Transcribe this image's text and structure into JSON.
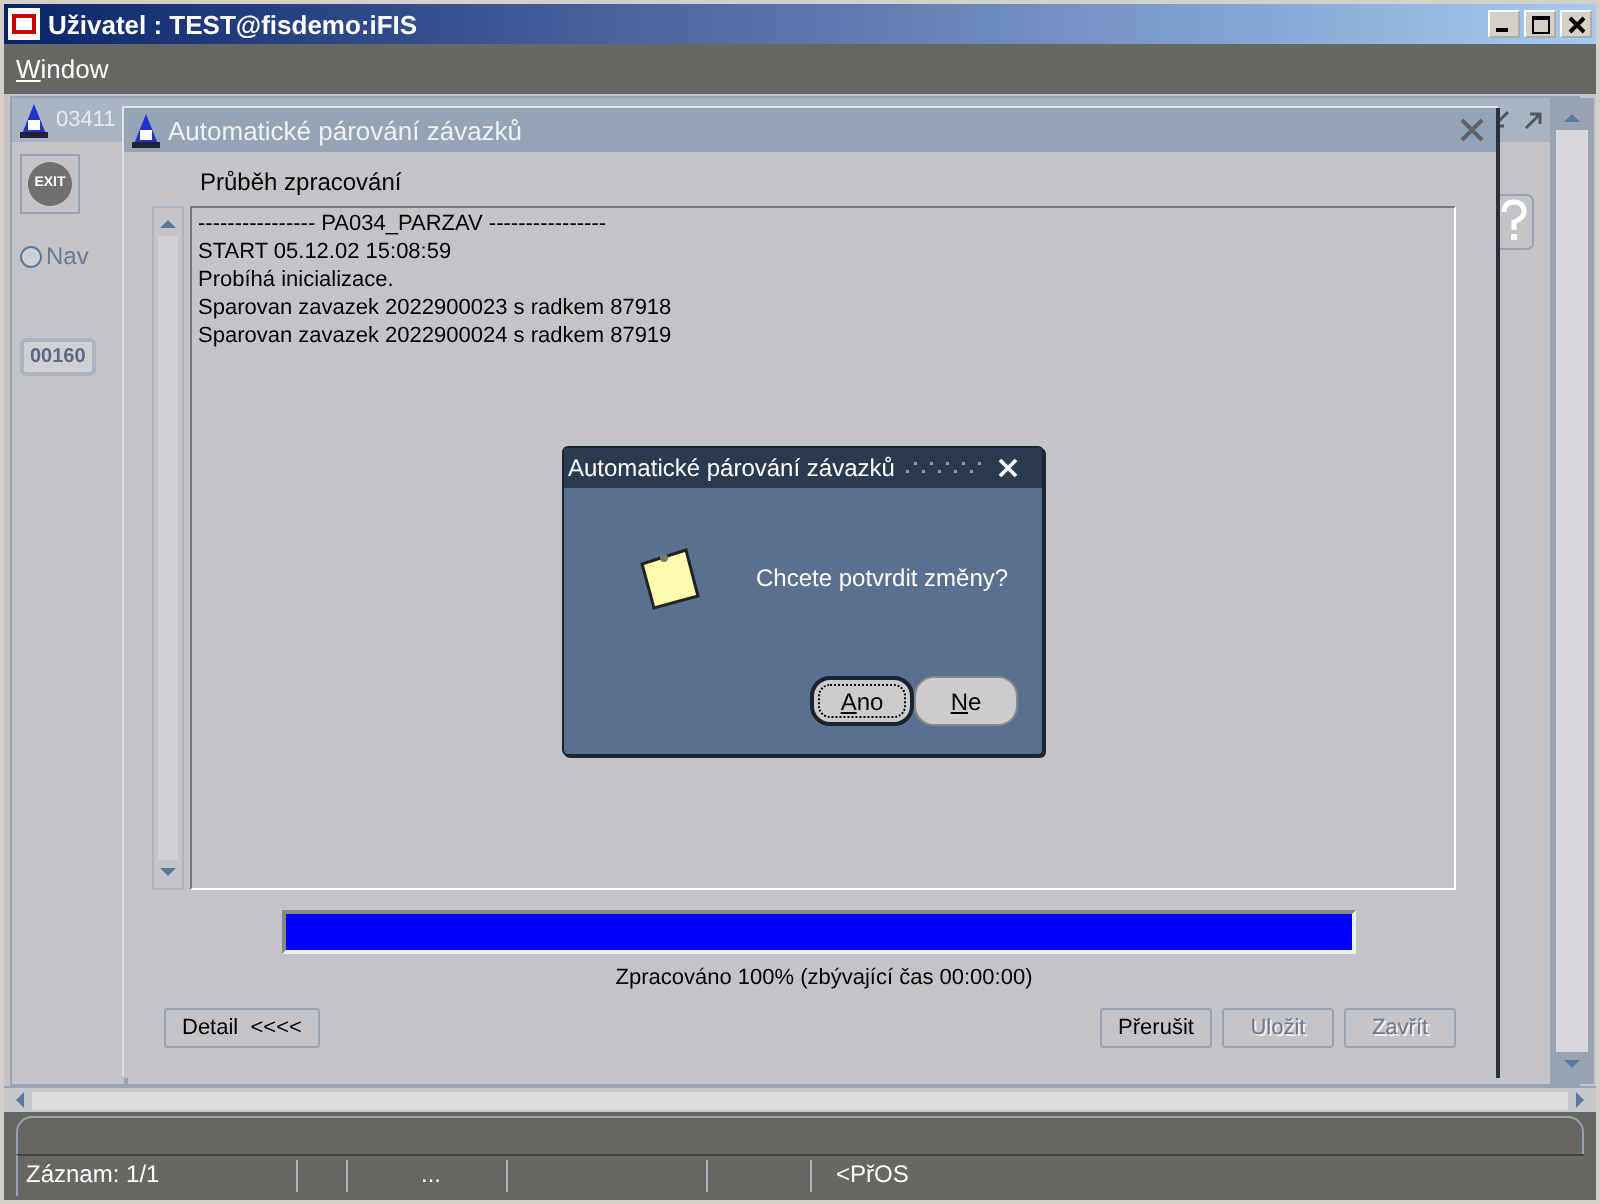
{
  "window": {
    "title": "Uživatel : TEST@fisdemo:iFIS"
  },
  "menu": [
    {
      "label": "Window"
    }
  ],
  "back_window": {
    "title": "03411",
    "toolbar_button": "EXIT",
    "nav_option": {
      "label": "Nav",
      "selected": false
    },
    "record_field": "00160"
  },
  "front_window": {
    "title": "Automatické párování závazků",
    "log_label": "Průběh zpracování",
    "log_lines": [
      "---------------- PA034_PARZAV ----------------",
      "START 05.12.02 15:08:59",
      "Probíhá inicializace.",
      "Sparovan zavazek 2022900023 s radkem 87918",
      "Sparovan zavazek 2022900024 s radkem 87919"
    ],
    "progress": {
      "level": 1,
      "caption": "Zpracováno 100% (zbývající čas 00:00:00)"
    },
    "buttons": [
      {
        "label": "Detail  <<<<",
        "disabled": false
      },
      {
        "label": "Přerušit",
        "disabled": false
      },
      {
        "label": "Uložit",
        "disabled": true
      },
      {
        "label": "Zavřít",
        "disabled": true
      }
    ]
  },
  "dialog": {
    "title": "Automatické párování závazků",
    "message": "Chcete potvrdit změny?",
    "buttons": [
      {
        "label": "Ano",
        "selected": true
      },
      {
        "label": "Ne",
        "selected": false
      }
    ]
  },
  "status_bar": {
    "fields": [
      {
        "text": "Záznam: 1/1"
      },
      {
        "text": "..."
      },
      {
        "text": "<PřOS"
      }
    ]
  }
}
